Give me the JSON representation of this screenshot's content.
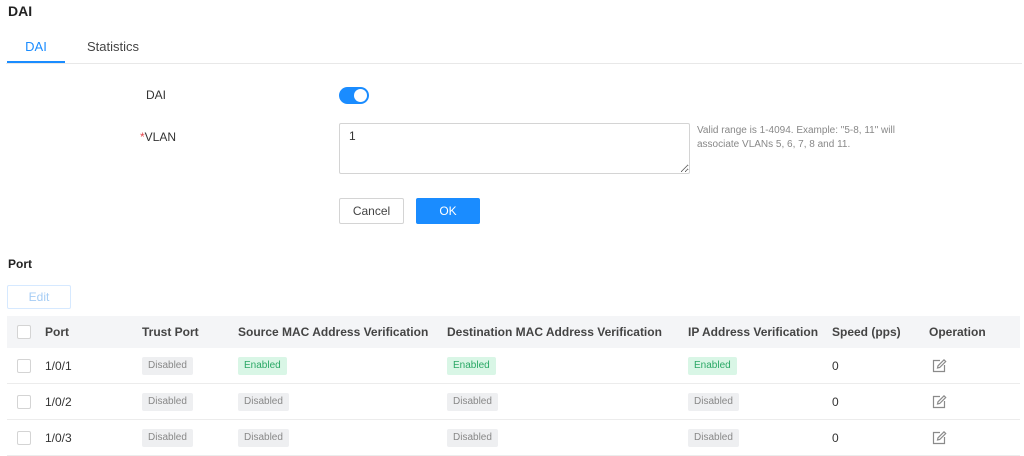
{
  "page_title": "DAI",
  "tabs": [
    {
      "label": "DAI",
      "active": true
    },
    {
      "label": "Statistics",
      "active": false
    }
  ],
  "form": {
    "dai_label": "DAI",
    "dai_enabled": true,
    "vlan_required_mark": "*",
    "vlan_label": "VLAN",
    "vlan_value": "1",
    "vlan_hint": "Valid range is 1-4094. Example: \"5-8, 11\" will associate VLANs 5, 6, 7, 8 and 11.",
    "cancel_label": "Cancel",
    "ok_label": "OK"
  },
  "port_section": {
    "title": "Port",
    "edit_label": "Edit",
    "columns": [
      "Port",
      "Trust Port",
      "Source MAC Address Verification",
      "Destination MAC Address Verification",
      "IP Address Verification",
      "Speed (pps)",
      "Operation"
    ],
    "rows": [
      {
        "port": "1/0/1",
        "trust": "Disabled",
        "src_mac": "Enabled",
        "dst_mac": "Enabled",
        "ip": "Enabled",
        "speed": "0"
      },
      {
        "port": "1/0/2",
        "trust": "Disabled",
        "src_mac": "Disabled",
        "dst_mac": "Disabled",
        "ip": "Disabled",
        "speed": "0"
      },
      {
        "port": "1/0/3",
        "trust": "Disabled",
        "src_mac": "Disabled",
        "dst_mac": "Disabled",
        "ip": "Disabled",
        "speed": "0"
      }
    ]
  },
  "colors": {
    "accent": "#1a8cff",
    "enabled_badge_bg": "#d9f6e6",
    "enabled_badge_text": "#2aa866",
    "disabled_badge_bg": "#eeeff1"
  },
  "icons": {
    "operation": "edit-icon",
    "toggle": "toggle-switch"
  }
}
